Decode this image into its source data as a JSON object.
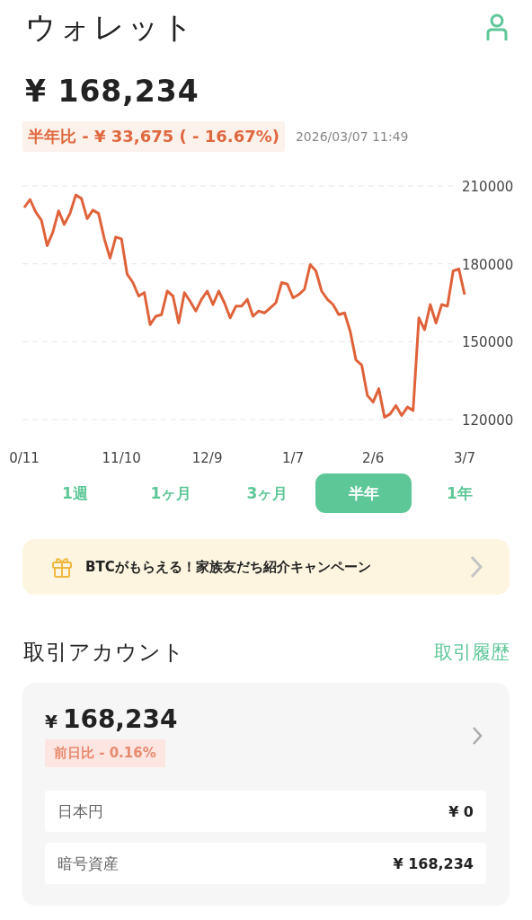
{
  "header": {
    "title": "ウォレット"
  },
  "balance": {
    "amount": "¥ 168,234",
    "change": "半年比 - ¥ 33,675 ( - 16.67%)",
    "timestamp": "2026/03/07 11:49"
  },
  "chart_data": {
    "type": "line",
    "ylim": [
      120000,
      210000
    ],
    "yticks": [
      210000,
      180000,
      150000,
      120000
    ],
    "categories": [
      "0/11",
      null,
      null,
      null,
      null,
      null,
      null,
      null,
      null,
      null,
      null,
      null,
      null,
      null,
      null,
      null,
      null,
      "11/10",
      null,
      null,
      null,
      null,
      null,
      null,
      null,
      null,
      null,
      null,
      null,
      null,
      null,
      null,
      "12/9",
      null,
      null,
      null,
      null,
      null,
      null,
      null,
      null,
      null,
      null,
      null,
      null,
      null,
      null,
      "1/7",
      null,
      null,
      null,
      null,
      null,
      null,
      null,
      null,
      null,
      null,
      null,
      null,
      null,
      "2/6",
      null,
      null,
      null,
      null,
      null,
      null,
      null,
      null,
      null,
      null,
      null,
      null,
      null,
      null,
      null,
      "3/7"
    ],
    "series": [
      {
        "color": "#e0623a",
        "values": [
          201700,
          204800,
          200000,
          196800,
          187000,
          192200,
          200400,
          195200,
          199400,
          206500,
          205200,
          197400,
          200700,
          199400,
          189600,
          182200,
          190300,
          189600,
          176000,
          172800,
          167600,
          168900,
          156600,
          159800,
          160400,
          169500,
          167600,
          157200,
          168900,
          165600,
          161800,
          166300,
          169500,
          164300,
          169500,
          165000,
          159200,
          163700,
          163700,
          166300,
          159800,
          161800,
          161100,
          163000,
          165000,
          172800,
          172200,
          166900,
          168200,
          170200,
          179700,
          177300,
          169500,
          166300,
          164300,
          160400,
          161100,
          154000,
          143000,
          141000,
          129300,
          126700,
          131900,
          120900,
          122200,
          125400,
          121600,
          124800,
          123500,
          159200,
          154600,
          164300,
          157200,
          164300,
          163700,
          177300,
          178000,
          168200
        ]
      }
    ]
  },
  "periods": [
    {
      "label": "1週",
      "selected": false
    },
    {
      "label": "1ヶ月",
      "selected": false
    },
    {
      "label": "3ヶ月",
      "selected": false
    },
    {
      "label": "半年",
      "selected": true
    },
    {
      "label": "1年",
      "selected": false
    }
  ],
  "banner": {
    "text": "BTCがもらえる！家族友だち紹介キャンペーン"
  },
  "account": {
    "title": "取引アカウント",
    "link": "取引履歴",
    "currency": "¥",
    "amount": "168,234",
    "change": "前日比 - 0.16%",
    "rows": [
      {
        "label": "日本円",
        "value": "¥ 0"
      },
      {
        "label": "暗号資産",
        "value": "¥ 168,234"
      }
    ]
  }
}
